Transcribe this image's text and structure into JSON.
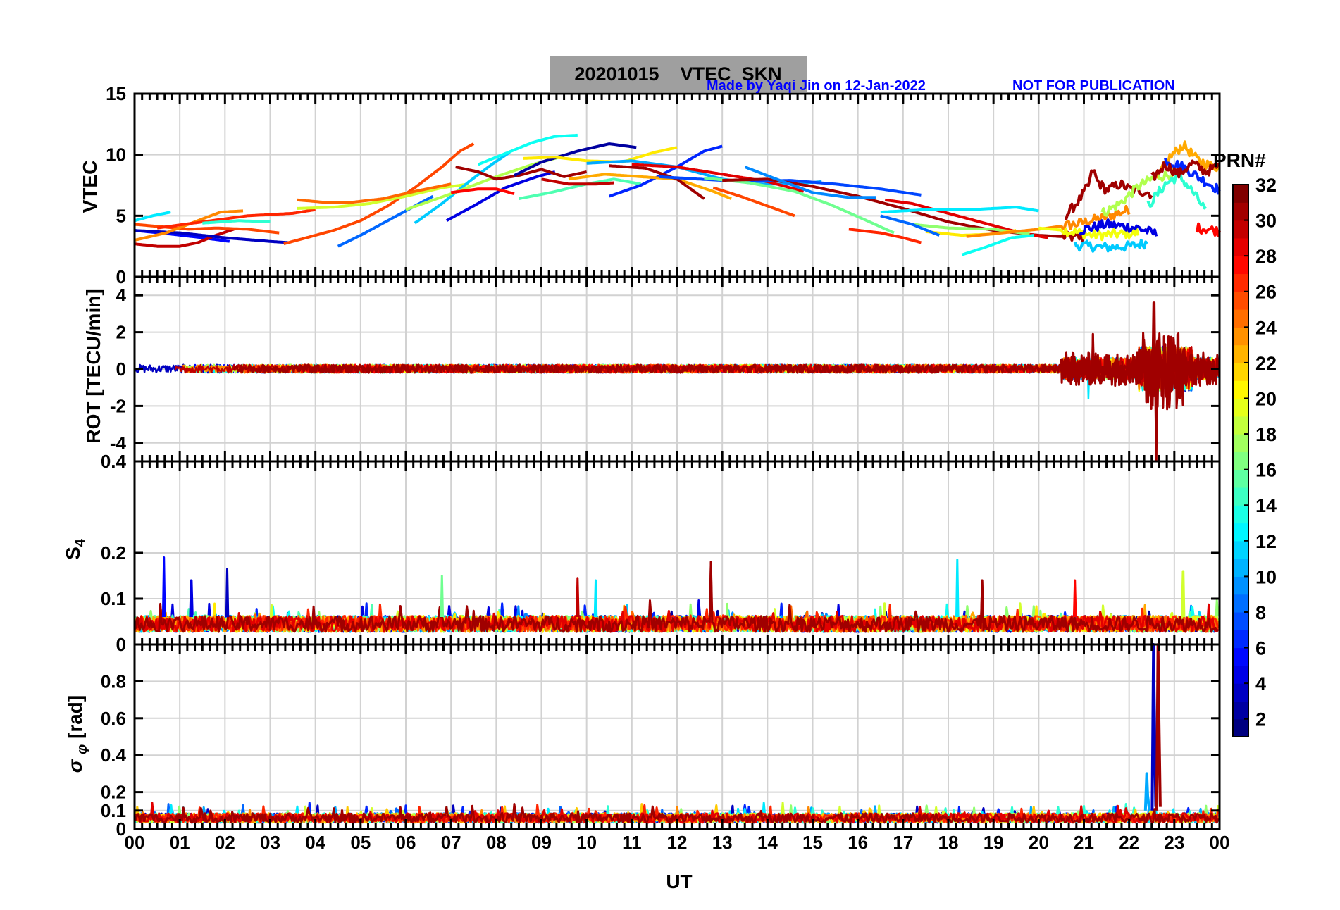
{
  "figure": {
    "title_date": "20201015",
    "title_text": "VTEC  SKN",
    "credit": "Made by Yaqi Jin on 12-Jan-2022",
    "notice": "NOT FOR PUBLICATION",
    "xlabel": "UT",
    "colorbar_label": "PRN#"
  },
  "colors": {
    "background": "#ffffff",
    "grid": "#d0d0d0",
    "title_box": "#9f9f9f",
    "credit_text": "#0000ff"
  },
  "colorbar": {
    "colormap": "jet",
    "range": [
      1,
      32
    ],
    "ticks": [
      2,
      4,
      6,
      8,
      10,
      12,
      14,
      16,
      18,
      20,
      22,
      24,
      26,
      28,
      30,
      32
    ]
  },
  "chart_data": [
    {
      "type": "line",
      "panel": "vtec",
      "ylabel": "VTEC",
      "ylim": [
        0,
        15
      ],
      "yticks": [
        0,
        5,
        10,
        15
      ],
      "xlim": [
        0,
        24
      ],
      "xticks": [
        "00",
        "01",
        "02",
        "03",
        "04",
        "05",
        "06",
        "07",
        "08",
        "09",
        "10",
        "11",
        "12",
        "13",
        "14",
        "15",
        "16",
        "17",
        "18",
        "19",
        "20",
        "21",
        "22",
        "23",
        "00"
      ],
      "grid": true,
      "series": [
        {
          "prn": 12,
          "x": [
            0.0,
            0.4,
            0.8
          ],
          "y": [
            4.6,
            5.0,
            5.3
          ]
        },
        {
          "prn": 5,
          "x": [
            0.0,
            0.8,
            1.5,
            2.1
          ],
          "y": [
            3.8,
            3.5,
            3.2,
            2.9
          ]
        },
        {
          "prn": 30,
          "x": [
            0.0,
            0.5,
            1.0,
            1.4,
            1.8,
            2.2
          ],
          "y": [
            2.7,
            2.5,
            2.5,
            2.8,
            3.4,
            3.9
          ]
        },
        {
          "prn": 26,
          "x": [
            0.0,
            0.6,
            1.2,
            1.8,
            2.5,
            3.2
          ],
          "y": [
            4.3,
            4.1,
            3.9,
            4.0,
            3.9,
            3.6
          ]
        },
        {
          "prn": 3,
          "x": [
            0.0,
            1.0,
            2.0,
            3.0,
            3.4
          ],
          "y": [
            3.8,
            3.6,
            3.2,
            2.9,
            2.8
          ]
        },
        {
          "prn": 24,
          "x": [
            0.0,
            0.7,
            1.4,
            1.9,
            2.4
          ],
          "y": [
            3.0,
            3.6,
            4.6,
            5.3,
            5.4
          ]
        },
        {
          "prn": 27,
          "x": [
            0.5,
            1.5,
            2.5,
            3.5,
            4.0
          ],
          "y": [
            4.0,
            4.5,
            5.0,
            5.2,
            5.5
          ]
        },
        {
          "prn": 14,
          "x": [
            1.5,
            2.3,
            3.0
          ],
          "y": [
            4.4,
            4.6,
            4.5
          ]
        },
        {
          "prn": 26,
          "x": [
            3.3,
            3.8,
            4.4,
            5.0,
            5.6,
            6.2,
            6.8,
            7.2,
            7.5
          ],
          "y": [
            2.7,
            3.2,
            3.8,
            4.6,
            5.8,
            7.3,
            9.0,
            10.3,
            10.9
          ]
        },
        {
          "prn": 19,
          "x": [
            3.6,
            4.4,
            5.2,
            6.0,
            6.8,
            7.4
          ],
          "y": [
            5.6,
            5.7,
            6.0,
            6.6,
            7.3,
            7.6
          ]
        },
        {
          "prn": 25,
          "x": [
            3.6,
            4.2,
            4.8,
            5.5,
            6.2,
            7.0
          ],
          "y": [
            6.3,
            6.1,
            6.1,
            6.4,
            7.0,
            7.6
          ]
        },
        {
          "prn": 8,
          "x": [
            4.5,
            5.0,
            5.6,
            6.2,
            6.6
          ],
          "y": [
            2.5,
            3.4,
            4.6,
            5.8,
            6.6
          ]
        },
        {
          "prn": 11,
          "x": [
            6.2,
            6.8,
            7.4,
            7.9,
            8.3
          ],
          "y": [
            4.4,
            6.0,
            7.8,
            9.2,
            10.2
          ]
        },
        {
          "prn": 18,
          "x": [
            6.0,
            7.0,
            8.0,
            8.8,
            9.4
          ],
          "y": [
            5.5,
            6.8,
            8.2,
            9.2,
            9.8
          ]
        },
        {
          "prn": 4,
          "x": [
            6.9,
            7.5,
            8.2,
            8.9,
            9.3
          ],
          "y": [
            4.6,
            5.8,
            7.3,
            8.2,
            8.6
          ]
        },
        {
          "prn": 13,
          "x": [
            7.6,
            8.2,
            8.8,
            9.3,
            9.8
          ],
          "y": [
            9.2,
            10.1,
            11.0,
            11.5,
            11.6
          ]
        },
        {
          "prn": 31,
          "x": [
            7.1,
            7.6,
            8.0,
            8.5,
            9.0,
            9.5,
            10.0
          ],
          "y": [
            9.0,
            8.6,
            8.0,
            8.3,
            8.8,
            8.2,
            8.6
          ]
        },
        {
          "prn": 28,
          "x": [
            7.0,
            7.6,
            8.0,
            8.4
          ],
          "y": [
            6.9,
            7.2,
            7.2,
            6.8
          ]
        },
        {
          "prn": 15,
          "x": [
            8.5,
            9.2,
            10.0,
            10.6,
            11.2
          ],
          "y": [
            6.4,
            6.9,
            7.6,
            8.0,
            7.6
          ]
        },
        {
          "prn": 2,
          "x": [
            8.4,
            9.0,
            9.8,
            10.5,
            11.1
          ],
          "y": [
            8.3,
            9.4,
            10.3,
            10.9,
            10.6
          ]
        },
        {
          "prn": 21,
          "x": [
            8.6,
            9.3,
            10.0,
            10.8,
            11.5,
            12.0
          ],
          "y": [
            9.7,
            9.8,
            9.5,
            9.4,
            10.2,
            10.6
          ]
        },
        {
          "prn": 30,
          "x": [
            9.0,
            9.6,
            10.2,
            10.6
          ],
          "y": [
            8.0,
            7.6,
            7.6,
            7.7
          ]
        },
        {
          "prn": 6,
          "x": [
            10.5,
            11.2,
            12.0,
            12.6,
            13.0
          ],
          "y": [
            6.6,
            7.5,
            9.0,
            10.3,
            10.7
          ]
        },
        {
          "prn": 23,
          "x": [
            9.6,
            10.4,
            11.2,
            12.0,
            12.8,
            13.2
          ],
          "y": [
            8.0,
            8.4,
            8.2,
            8.0,
            7.0,
            6.4
          ]
        },
        {
          "prn": 10,
          "x": [
            10.0,
            11.0,
            12.0,
            13.0,
            13.8,
            14.6,
            15.2
          ],
          "y": [
            9.3,
            9.5,
            9.0,
            8.0,
            7.6,
            7.6,
            7.8
          ]
        },
        {
          "prn": 29,
          "x": [
            11.0,
            12.0,
            13.0,
            14.0,
            14.8
          ],
          "y": [
            9.2,
            9.0,
            8.4,
            7.8,
            7.0
          ]
        },
        {
          "prn": 31,
          "x": [
            10.5,
            11.3,
            12.0,
            12.6
          ],
          "y": [
            9.1,
            8.9,
            8.0,
            6.4
          ]
        },
        {
          "prn": 7,
          "x": [
            11.6,
            12.5,
            13.5,
            14.5,
            15.5,
            16.5,
            17.4
          ],
          "y": [
            8.2,
            8.0,
            7.8,
            7.9,
            7.6,
            7.2,
            6.7
          ]
        },
        {
          "prn": 26,
          "x": [
            12.8,
            13.4,
            14.0,
            14.6
          ],
          "y": [
            7.3,
            6.6,
            5.8,
            5.0
          ]
        },
        {
          "prn": 16,
          "x": [
            12.6,
            13.6,
            14.6,
            15.4,
            16.2,
            16.8
          ],
          "y": [
            8.1,
            7.7,
            7.0,
            5.9,
            4.6,
            3.6
          ]
        },
        {
          "prn": 31,
          "x": [
            13.0,
            14.0,
            15.0,
            16.0,
            17.0,
            18.0,
            19.0,
            20.0,
            21.0
          ],
          "y": [
            7.9,
            8.0,
            7.4,
            6.6,
            5.6,
            4.5,
            3.8,
            3.4,
            3.2
          ]
        },
        {
          "prn": 9,
          "x": [
            13.5,
            14.2,
            15.0,
            15.8,
            16.4
          ],
          "y": [
            9.0,
            8.0,
            6.9,
            6.5,
            6.5
          ]
        },
        {
          "prn": 27,
          "x": [
            15.8,
            16.5,
            17.0,
            17.4
          ],
          "y": [
            3.9,
            3.6,
            3.2,
            2.8
          ]
        },
        {
          "prn": 29,
          "x": [
            16.6,
            17.2,
            18.0,
            18.8,
            19.6,
            20.2
          ],
          "y": [
            6.3,
            6.0,
            5.2,
            4.4,
            3.6,
            3.2
          ]
        },
        {
          "prn": 12,
          "x": [
            16.5,
            17.5,
            18.5,
            19.5,
            20.0
          ],
          "y": [
            5.3,
            5.5,
            5.5,
            5.7,
            5.4
          ]
        },
        {
          "prn": 17,
          "x": [
            17.2,
            18.0,
            19.0,
            19.8
          ],
          "y": [
            4.3,
            4.0,
            3.9,
            3.5
          ]
        },
        {
          "prn": 21,
          "x": [
            17.5,
            18.3,
            19.0,
            19.5
          ],
          "y": [
            3.7,
            3.4,
            3.5,
            3.8
          ]
        },
        {
          "prn": 8,
          "x": [
            16.5,
            17.2,
            17.8
          ],
          "y": [
            5.0,
            4.3,
            3.4
          ]
        },
        {
          "prn": 24,
          "x": [
            18.4,
            19.2,
            20.0,
            20.8,
            21.5,
            22.0
          ],
          "y": [
            3.3,
            3.6,
            3.9,
            4.3,
            4.9,
            5.5
          ]
        },
        {
          "prn": 13,
          "x": [
            18.3,
            18.8,
            19.4,
            19.9
          ],
          "y": [
            1.8,
            2.4,
            3.2,
            3.4
          ]
        },
        {
          "prn": 20,
          "x": [
            20.0,
            20.6,
            21.2,
            21.8,
            22.2
          ],
          "y": [
            4.0,
            3.8,
            3.4,
            3.5,
            3.6
          ]
        },
        {
          "prn": 11,
          "x": [
            20.8,
            21.5,
            22.0,
            22.4
          ],
          "y": [
            2.6,
            2.4,
            2.5,
            2.8
          ]
        },
        {
          "prn": 4,
          "x": [
            20.9,
            21.5,
            22.2,
            22.6
          ],
          "y": [
            3.8,
            4.3,
            4.0,
            3.5
          ]
        },
        {
          "prn": 31,
          "x": [
            20.6,
            20.9,
            21.1,
            21.2,
            21.3,
            21.5,
            21.8,
            22.0,
            22.3,
            22.5
          ],
          "y": [
            5.0,
            6.3,
            7.5,
            8.8,
            7.8,
            7.1,
            7.6,
            7.2,
            7.0,
            6.8
          ]
        },
        {
          "prn": 18,
          "x": [
            21.4,
            21.8,
            22.2,
            22.6,
            23.0
          ],
          "y": [
            5.2,
            6.0,
            7.4,
            8.2,
            8.4
          ]
        },
        {
          "prn": 23,
          "x": [
            22.6,
            22.9,
            23.2,
            23.5,
            23.8,
            24.0
          ],
          "y": [
            8.0,
            9.8,
            10.8,
            9.6,
            9.1,
            9.0
          ]
        },
        {
          "prn": 6,
          "x": [
            22.8,
            23.2,
            23.6,
            24.0
          ],
          "y": [
            9.6,
            9.0,
            8.0,
            7.1
          ]
        },
        {
          "prn": 14,
          "x": [
            22.4,
            22.8,
            23.1,
            23.4,
            23.7
          ],
          "y": [
            5.7,
            7.6,
            8.3,
            7.0,
            5.4
          ]
        },
        {
          "prn": 31,
          "x": [
            22.5,
            22.8,
            23.1,
            23.4,
            23.7,
            24.0
          ],
          "y": [
            8.0,
            9.2,
            8.4,
            9.3,
            8.6,
            9.1
          ]
        },
        {
          "prn": 28,
          "x": [
            23.5,
            23.8,
            24.0
          ],
          "y": [
            4.0,
            3.9,
            3.7
          ]
        }
      ]
    },
    {
      "type": "line",
      "panel": "rot",
      "ylabel": "ROT [TECU/min]",
      "ylim": [
        -5,
        5
      ],
      "yticks": [
        -4,
        -2,
        0,
        2,
        4
      ],
      "xlim": [
        0,
        24
      ],
      "grid": true,
      "description": "ROT for all PRNs stays within about ±0.3 TECU/min until ~20.5 UT; strong fluctuations appear from 20.5 to 24 UT",
      "peaks": [
        {
          "prn": 31,
          "x": 21.2,
          "y": 1.9
        },
        {
          "prn": 12,
          "x": 21.1,
          "y": -1.6
        },
        {
          "prn": 31,
          "x": 22.55,
          "y": 3.6
        },
        {
          "prn": 31,
          "x": 22.6,
          "y": -5.0
        },
        {
          "prn": 17,
          "x": 22.3,
          "y": -2.5
        },
        {
          "prn": 17,
          "x": 22.4,
          "y": 2.2
        },
        {
          "prn": 6,
          "x": 23.3,
          "y": -2.2
        }
      ]
    },
    {
      "type": "line",
      "panel": "s4",
      "ylabel": "S4",
      "ylim": [
        0,
        0.4
      ],
      "yticks": [
        0,
        0.1,
        0.2,
        0.4
      ],
      "xlim": [
        0,
        24
      ],
      "grid": true,
      "description": "S4 baseline near 0.04–0.07 for all PRNs with occasional spikes",
      "spikes": [
        {
          "prn": 5,
          "x": 0.65,
          "y": 0.19
        },
        {
          "prn": 4,
          "x": 1.25,
          "y": 0.14
        },
        {
          "prn": 3,
          "x": 2.05,
          "y": 0.165
        },
        {
          "prn": 16,
          "x": 6.8,
          "y": 0.15
        },
        {
          "prn": 30,
          "x": 9.8,
          "y": 0.145
        },
        {
          "prn": 12,
          "x": 10.2,
          "y": 0.14
        },
        {
          "prn": 31,
          "x": 12.75,
          "y": 0.18
        },
        {
          "prn": 12,
          "x": 18.2,
          "y": 0.185
        },
        {
          "prn": 31,
          "x": 18.75,
          "y": 0.14
        },
        {
          "prn": 28,
          "x": 20.8,
          "y": 0.14
        },
        {
          "prn": 19,
          "x": 23.2,
          "y": 0.16
        }
      ]
    },
    {
      "type": "line",
      "panel": "sigma_phi",
      "ylabel": "σ_φ [rad]",
      "ylim": [
        0,
        1.0
      ],
      "yticks": [
        0,
        0.1,
        0.2,
        0.4,
        0.6,
        0.8
      ],
      "xlim": [
        0,
        24
      ],
      "grid": true,
      "description": "Phase scintillation index near 0.04–0.1 rad, with two large spikes at ~22.6 UT",
      "spikes": [
        {
          "prn": 3,
          "x": 22.55,
          "y": 1.0
        },
        {
          "prn": 31,
          "x": 22.65,
          "y": 1.0
        },
        {
          "prn": 10,
          "x": 22.4,
          "y": 0.3
        }
      ]
    }
  ]
}
